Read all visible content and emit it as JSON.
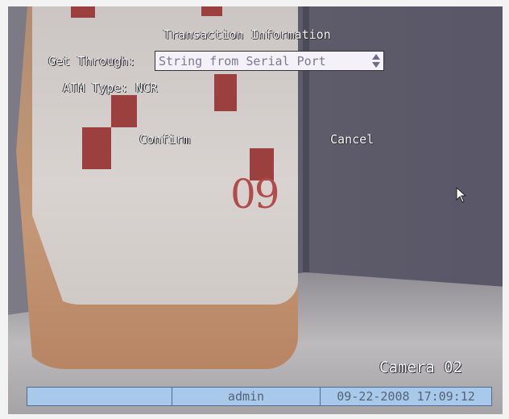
{
  "dialog": {
    "title": "Transaction Information",
    "get_through_label": "Get Through:",
    "get_through_value": "String from Serial Port",
    "atm_type_label": "ATM Type:",
    "atm_type_value": "NCR",
    "confirm_label": "Confirm",
    "cancel_label": "Cancel"
  },
  "overlay": {
    "camera_label": "Camera 02"
  },
  "status_bar": {
    "cell1": "",
    "user": "admin",
    "datetime": "09-22-2008 17:09:12"
  },
  "background": {
    "calendar_text": "09"
  },
  "icons": [
    "updown-arrows-icon",
    "mouse-pointer-icon"
  ]
}
